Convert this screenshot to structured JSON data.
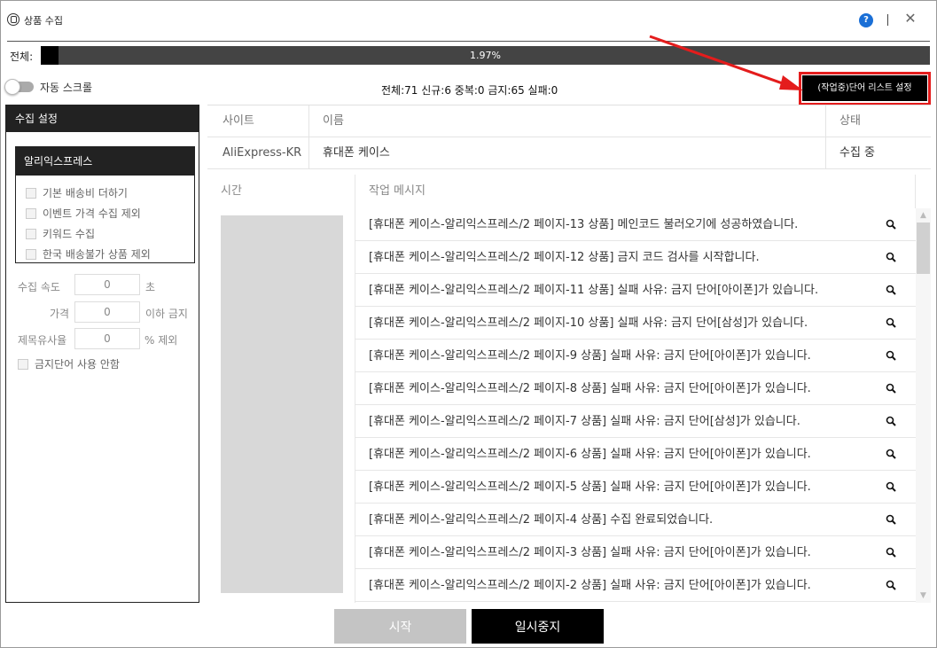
{
  "window": {
    "title": "상품 수집",
    "help_glyph": "?",
    "close_glyph": "✕"
  },
  "progress": {
    "label": "전체:",
    "percent": 1.97,
    "percent_text": "1.97%"
  },
  "toolbar": {
    "auto_scroll_label": "자동 스크롤",
    "auto_scroll_on": false,
    "stats": "전체:71 신규:6 중복:0 금지:65 실패:0",
    "wordlist_button": "(작업중)단어 리스트 설정"
  },
  "settings": {
    "header": "수집 설정",
    "group_header": "알리익스프레스",
    "checkboxes": [
      "기본 배송비 더하기",
      "이벤트 가격 수집 제외",
      "키워드 수집",
      "한국 배송불가 상품 제외"
    ],
    "speed_label": "수집 속도",
    "speed_value": "0",
    "speed_unit": "초",
    "price_label": "가격",
    "price_value": "0",
    "price_unit": "이하 금지",
    "similar_label": "제목유사율",
    "similar_value": "0",
    "similar_unit": "% 제외",
    "no_banned_words": "금지단어 사용 안함"
  },
  "info_table": {
    "headers": {
      "site": "사이트",
      "name": "이름",
      "status": "상태"
    },
    "row": {
      "site": "AliExpress-KR",
      "name": "휴대폰 케이스",
      "status": "수집 중"
    }
  },
  "log": {
    "headers": {
      "time": "시간",
      "message": "작업 메시지"
    },
    "rows": [
      "[휴대폰 케이스-알리익스프레스/2 페이지-13 상품] 메인코드 불러오기에 성공하였습니다.",
      "[휴대폰 케이스-알리익스프레스/2 페이지-12 상품] 금지 코드 검사를 시작합니다.",
      "[휴대폰 케이스-알리익스프레스/2 페이지-11 상품] 실패 사유: 금지 단어[아이폰]가 있습니다.",
      "[휴대폰 케이스-알리익스프레스/2 페이지-10 상품] 실패 사유: 금지 단어[삼성]가 있습니다.",
      "[휴대폰 케이스-알리익스프레스/2 페이지-9 상품] 실패 사유: 금지 단어[아이폰]가 있습니다.",
      "[휴대폰 케이스-알리익스프레스/2 페이지-8 상품] 실패 사유: 금지 단어[아이폰]가 있습니다.",
      "[휴대폰 케이스-알리익스프레스/2 페이지-7 상품] 실패 사유: 금지 단어[삼성]가 있습니다.",
      "[휴대폰 케이스-알리익스프레스/2 페이지-6 상품] 실패 사유: 금지 단어[아이폰]가 있습니다.",
      "[휴대폰 케이스-알리익스프레스/2 페이지-5 상품] 실패 사유: 금지 단어[아이폰]가 있습니다.",
      "[휴대폰 케이스-알리익스프레스/2 페이지-4 상품] 수집 완료되었습니다.",
      "[휴대폰 케이스-알리익스프레스/2 페이지-3 상품] 실패 사유: 금지 단어[아이폰]가 있습니다.",
      "[휴대폰 케이스-알리익스프레스/2 페이지-2 상품] 실패 사유: 금지 단어[아이폰]가 있습니다."
    ]
  },
  "buttons": {
    "start": "시작",
    "pause": "일시중지"
  },
  "colors": {
    "highlight": "#e41c1c",
    "help": "#1a6fd6"
  }
}
